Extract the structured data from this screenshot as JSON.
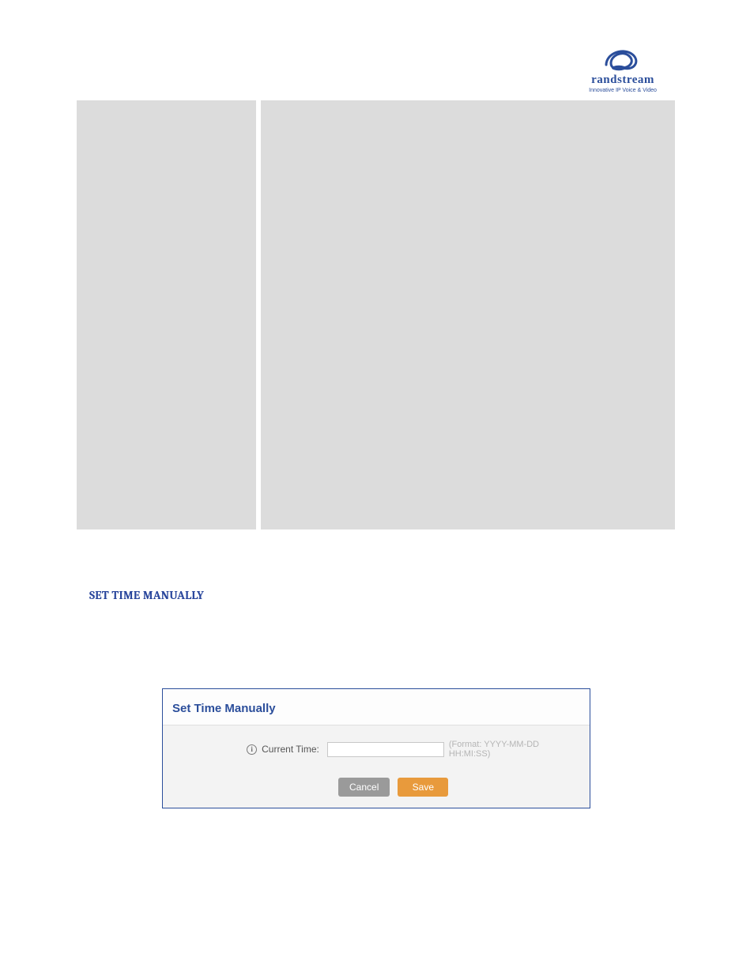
{
  "logo": {
    "brand_prefix": "G",
    "brand_text": "randstream",
    "tagline": "Innovative IP Voice & Video"
  },
  "section_heading": "SET TIME MANUALLY",
  "panel": {
    "title": "Set Time Manually",
    "field_label": "Current Time:",
    "input_value": "",
    "format_hint": "(Format: YYYY-MM-DD HH:MI:SS)",
    "cancel_label": "Cancel",
    "save_label": "Save"
  }
}
